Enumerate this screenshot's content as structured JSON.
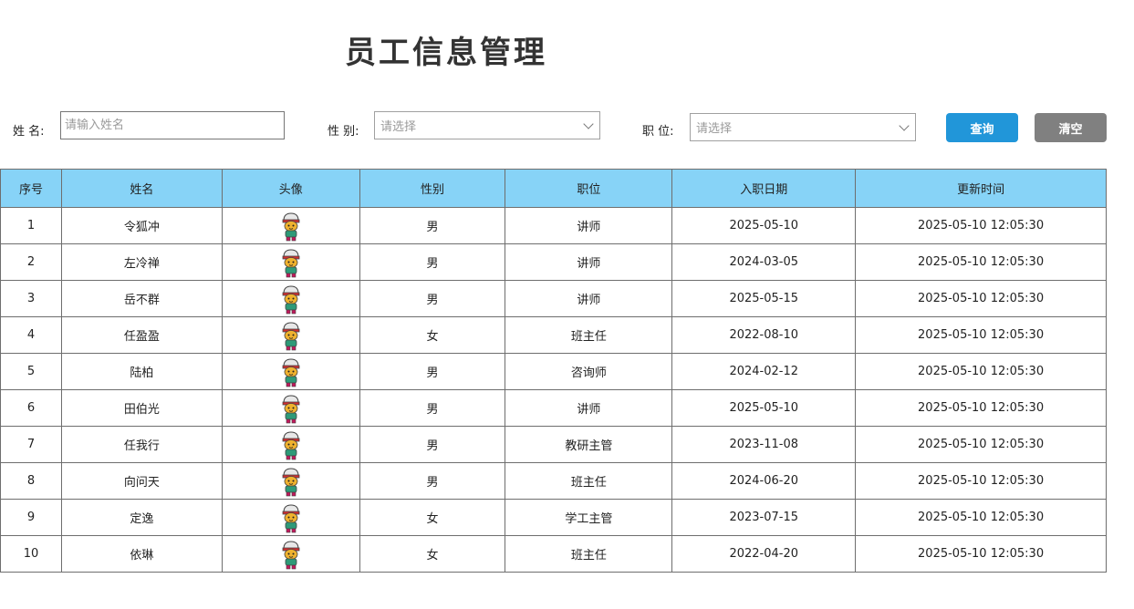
{
  "page": {
    "title": "员工信息管理"
  },
  "search": {
    "name_label": "姓 名:",
    "name_placeholder": "请输入姓名",
    "gender_label": "性 别:",
    "gender_value": "请选择",
    "position_label": "职 位:",
    "position_value": "请选择",
    "query_label": "查询",
    "clear_label": "清空"
  },
  "colors": {
    "header_bg": "#87d3f7",
    "query_button": "#2196d9",
    "clear_button": "#808080"
  },
  "table": {
    "columns": [
      "序号",
      "姓名",
      "头像",
      "性别",
      "职位",
      "入职日期",
      "更新时间"
    ],
    "rows": [
      {
        "id": "1",
        "name": "令狐冲",
        "avatar": "avatar-icon",
        "gender": "男",
        "position": "讲师",
        "entry_date": "2025-05-10",
        "update_time": "2025-05-10 12:05:30"
      },
      {
        "id": "2",
        "name": "左冷禅",
        "avatar": "avatar-icon",
        "gender": "男",
        "position": "讲师",
        "entry_date": "2024-03-05",
        "update_time": "2025-05-10 12:05:30"
      },
      {
        "id": "3",
        "name": "岳不群",
        "avatar": "avatar-icon",
        "gender": "男",
        "position": "讲师",
        "entry_date": "2025-05-15",
        "update_time": "2025-05-10 12:05:30"
      },
      {
        "id": "4",
        "name": "任盈盈",
        "avatar": "avatar-icon",
        "gender": "女",
        "position": "班主任",
        "entry_date": "2022-08-10",
        "update_time": "2025-05-10 12:05:30"
      },
      {
        "id": "5",
        "name": "陆柏",
        "avatar": "avatar-icon",
        "gender": "男",
        "position": "咨询师",
        "entry_date": "2024-02-12",
        "update_time": "2025-05-10 12:05:30"
      },
      {
        "id": "6",
        "name": "田伯光",
        "avatar": "avatar-icon",
        "gender": "男",
        "position": "讲师",
        "entry_date": "2025-05-10",
        "update_time": "2025-05-10 12:05:30"
      },
      {
        "id": "7",
        "name": "任我行",
        "avatar": "avatar-icon",
        "gender": "男",
        "position": "教研主管",
        "entry_date": "2023-11-08",
        "update_time": "2025-05-10 12:05:30"
      },
      {
        "id": "8",
        "name": "向问天",
        "avatar": "avatar-icon",
        "gender": "男",
        "position": "班主任",
        "entry_date": "2024-06-20",
        "update_time": "2025-05-10 12:05:30"
      },
      {
        "id": "9",
        "name": "定逸",
        "avatar": "avatar-icon",
        "gender": "女",
        "position": "学工主管",
        "entry_date": "2023-07-15",
        "update_time": "2025-05-10 12:05:30"
      },
      {
        "id": "10",
        "name": "依琳",
        "avatar": "avatar-icon",
        "gender": "女",
        "position": "班主任",
        "entry_date": "2022-04-20",
        "update_time": "2025-05-10 12:05:30"
      }
    ]
  }
}
